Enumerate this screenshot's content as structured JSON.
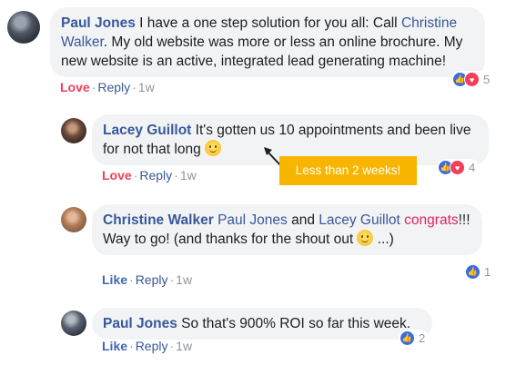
{
  "comments": [
    {
      "author": "Paul Jones",
      "text": " I have a one step solution for you all: Call ",
      "mention": "Christine Walker",
      "text2": ". My old website was more or less an online brochure. My new website is an active, integrated lead generating machine!",
      "action_primary": "Love",
      "reply": "Reply",
      "time": "1w",
      "reaction_count": "5"
    },
    {
      "author": "Lacey Guillot",
      "text": " It's gotten us 10 appointments and been live for not that long",
      "action_primary": "Love",
      "reply": "Reply",
      "time": "1w",
      "reaction_count": "4"
    },
    {
      "author": "Christine Walker",
      "mention1": "Paul Jones",
      "and": " and ",
      "mention2": "Lacey Guillot",
      "highlight": "congrats",
      "text": "!!! Way to go! (and thanks for the shout out ",
      "text2": "...)",
      "action_primary": "Like",
      "reply": "Reply",
      "time": "1w",
      "reaction_count": "1"
    },
    {
      "author": "Paul Jones",
      "text": " So that's 900% ROI so far this week.",
      "action_primary": "Like",
      "reply": "Reply",
      "time": "1w",
      "reaction_count": "2"
    }
  ],
  "callout": {
    "text": "Less than 2 weeks!"
  },
  "icons": {
    "like": "thumbs-up-icon",
    "love": "heart-icon",
    "emoji": "smile-emoji-icon",
    "arrow": "arrow-icon"
  },
  "colors": {
    "name": "#385898",
    "love": "#f33e58",
    "like": "#4267b2",
    "callout": "#f7b500",
    "bubble": "#f2f3f5"
  }
}
